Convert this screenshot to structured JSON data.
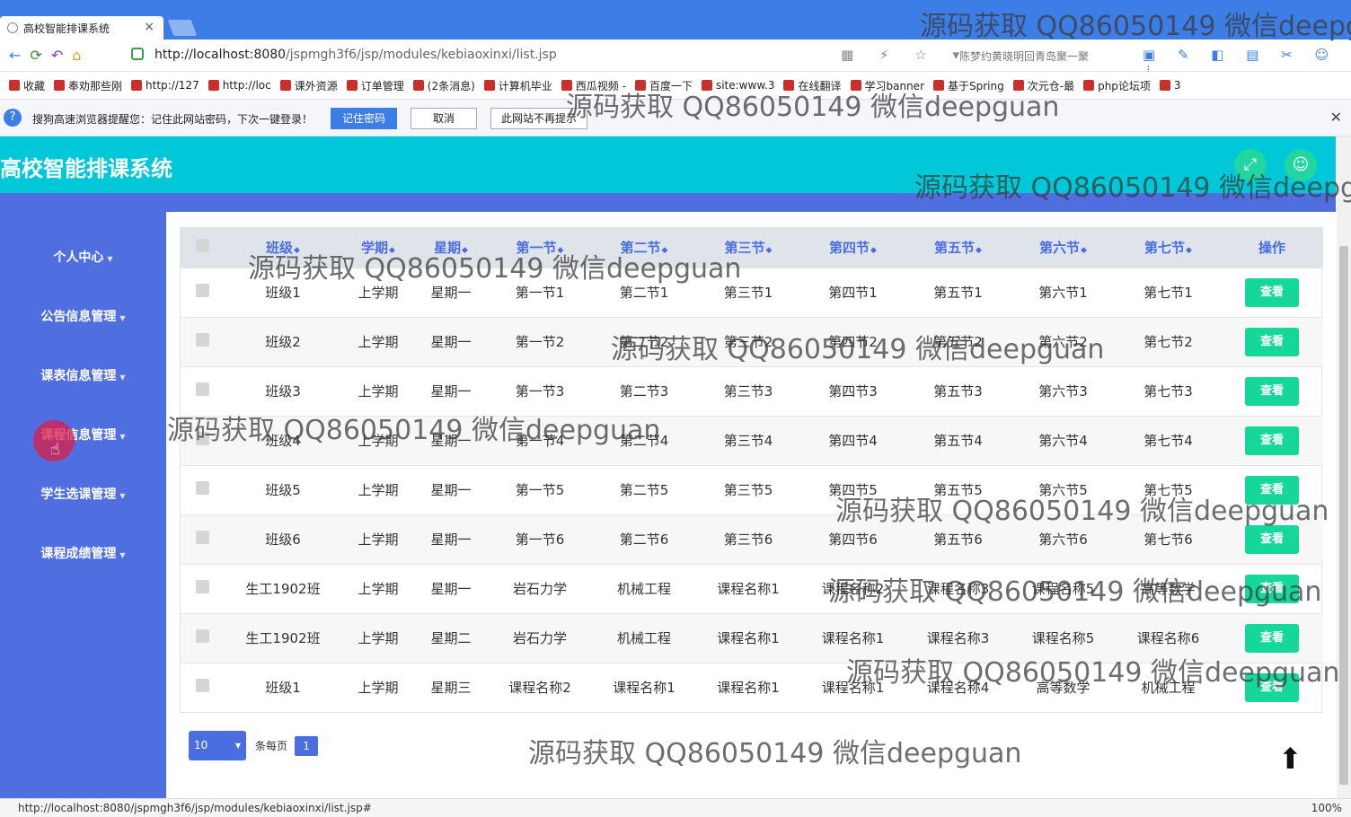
{
  "browser": {
    "tab_title": "高校智能排课系统",
    "tab_close": "×",
    "url_host": "http://localhost:8080",
    "url_path": "/jspmgh3f6/jsp/modules/kebiaoxinxi/list.jsp",
    "search_hint": "陈梦约黄晓明回青岛聚一聚",
    "bookmarks": [
      "收藏",
      "奉劝那些刚",
      "http://127",
      "http://loc",
      "课外资源",
      "订单管理",
      "(2条消息)",
      "计算机毕业",
      "西瓜视频 -",
      "百度一下",
      "site:www.3",
      "在线翻译",
      "学习banner",
      "基于Spring",
      "次元仓-最",
      "php论坛项",
      "3"
    ],
    "password_bar": {
      "message": "搜狗高速浏览器提醒您：记住此网站密码，下次一键登录！",
      "remember": "记住密码",
      "cancel": "取消",
      "never": "此网站不再提示"
    },
    "status_url": "http://localhost:8080/jspmgh3f6/jsp/modules/kebiaoxinxi/list.jsp#",
    "zoom": "100%"
  },
  "app": {
    "title": "高校智能排课系统",
    "menu": [
      "个人中心",
      "公告信息管理",
      "课表信息管理",
      "课程信息管理",
      "学生选课管理",
      "课程成绩管理"
    ]
  },
  "table": {
    "headers": [
      "班级",
      "学期",
      "星期",
      "第一节",
      "第二节",
      "第三节",
      "第四节",
      "第五节",
      "第六节",
      "第七节",
      "操作"
    ],
    "view_label": "查看",
    "rows": [
      [
        "班级1",
        "上学期",
        "星期一",
        "第一节1",
        "第二节1",
        "第三节1",
        "第四节1",
        "第五节1",
        "第六节1",
        "第七节1"
      ],
      [
        "班级2",
        "上学期",
        "星期一",
        "第一节2",
        "第二节2",
        "第三节2",
        "第四节2",
        "第五节2",
        "第六节2",
        "第七节2"
      ],
      [
        "班级3",
        "上学期",
        "星期一",
        "第一节3",
        "第二节3",
        "第三节3",
        "第四节3",
        "第五节3",
        "第六节3",
        "第七节3"
      ],
      [
        "班级4",
        "上学期",
        "星期一",
        "第一节4",
        "第二节4",
        "第三节4",
        "第四节4",
        "第五节4",
        "第六节4",
        "第七节4"
      ],
      [
        "班级5",
        "上学期",
        "星期一",
        "第一节5",
        "第二节5",
        "第三节5",
        "第四节5",
        "第五节5",
        "第六节5",
        "第七节5"
      ],
      [
        "班级6",
        "上学期",
        "星期一",
        "第一节6",
        "第二节6",
        "第三节6",
        "第四节6",
        "第五节6",
        "第六节6",
        "第七节6"
      ],
      [
        "生工1902班",
        "上学期",
        "星期一",
        "岩石力学",
        "机械工程",
        "课程名称1",
        "课程名称2",
        "课程名称3",
        "课程名称5",
        "高等数学"
      ],
      [
        "生工1902班",
        "上学期",
        "星期二",
        "岩石力学",
        "机械工程",
        "课程名称1",
        "课程名称1",
        "课程名称3",
        "课程名称5",
        "课程名称6"
      ],
      [
        "班级1",
        "上学期",
        "星期三",
        "课程名称2",
        "课程名称1",
        "课程名称1",
        "课程名称1",
        "课程名称4",
        "高等数学",
        "机械工程"
      ]
    ]
  },
  "pager": {
    "page_size": "10",
    "per_page_label": "条每页",
    "current_page": "1"
  },
  "watermark": "源码获取 QQ86050149 微信deepguan",
  "colors": {
    "header": "#00c8d8",
    "sidebar": "#4f6ee0",
    "accent": "#4a6ee0",
    "view_button": "#16d79a"
  }
}
